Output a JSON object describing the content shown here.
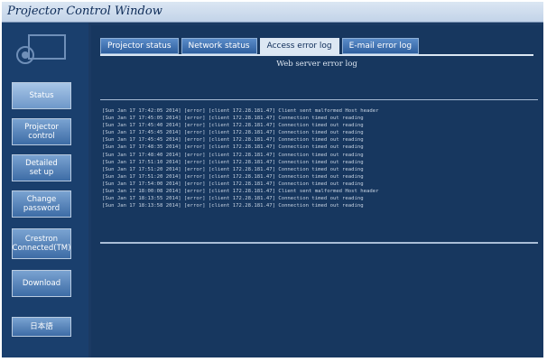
{
  "window": {
    "title": "Projector Control Window"
  },
  "sidebar": {
    "items": [
      {
        "label": "Status"
      },
      {
        "label": "Projector\ncontrol"
      },
      {
        "label": "Detailed\nset up"
      },
      {
        "label": "Change\npassword"
      },
      {
        "label": "Crestron\nConnected(TM)"
      },
      {
        "label": "Download"
      },
      {
        "label": "日本語"
      }
    ]
  },
  "main": {
    "tabs": [
      {
        "label": "Projector status"
      },
      {
        "label": "Network status"
      },
      {
        "label": "Access error log"
      },
      {
        "label": "E-mail error log"
      }
    ],
    "heading": "Web server error log",
    "log_lines": [
      "[Sun Jan 17 17:42:05 2014] [error] [client 172.28.181.47] Client sent malformed Host header",
      "[Sun Jan 17 17:45:05 2014] [error] [client 172.28.181.47] Connection timed out reading",
      "[Sun Jan 17 17:45:40 2014] [error] [client 172.28.181.47] Connection timed out reading",
      "[Sun Jan 17 17:45:45 2014] [error] [client 172.28.181.47] Connection timed out reading",
      "[Sun Jan 17 17:45:45 2014] [error] [client 172.28.181.47] Connection timed out reading",
      "[Sun Jan 17 17:48:35 2014] [error] [client 172.28.181.47] Connection timed out reading",
      "[Sun Jan 17 17:48:40 2014] [error] [client 172.28.181.47] Connection timed out reading",
      "[Sun Jan 17 17:51:10 2014] [error] [client 172.28.181.47] Connection timed out reading",
      "[Sun Jan 17 17:51:20 2014] [error] [client 172.28.181.47] Connection timed out reading",
      "[Sun Jan 17 17:51:20 2014] [error] [client 172.28.181.47] Connection timed out reading",
      "[Sun Jan 17 17:54:00 2014] [error] [client 172.28.181.47] Connection timed out reading",
      "[Sun Jan 17 18:00:08 2014] [error] [client 172.28.181.47] Client sent malformed Host header",
      "[Sun Jan 17 18:13:55 2014] [error] [client 172.28.181.47] Connection timed out reading",
      "[Sun Jan 17 18:13:58 2014] [error] [client 172.28.181.47] Connection timed out reading"
    ]
  }
}
